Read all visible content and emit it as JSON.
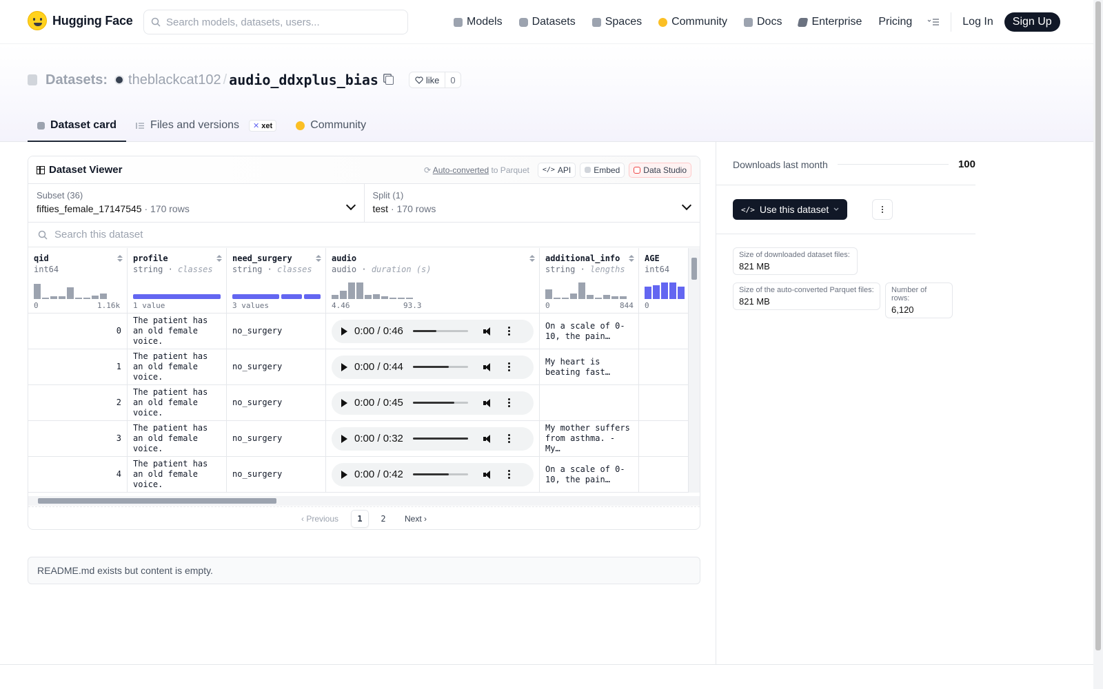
{
  "nav": {
    "brand": "Hugging Face",
    "search_placeholder": "Search models, datasets, users...",
    "links": [
      {
        "label": "Models",
        "icon": "cube-icon",
        "color": "#9ca3af"
      },
      {
        "label": "Datasets",
        "icon": "database-icon",
        "color": "#9ca3af"
      },
      {
        "label": "Spaces",
        "icon": "spaces-icon",
        "color": "#9ca3af"
      },
      {
        "label": "Community",
        "icon": "community-icon",
        "color": "#fbbf24"
      },
      {
        "label": "Docs",
        "icon": "book-icon",
        "color": "#9ca3af"
      },
      {
        "label": "Enterprise",
        "icon": "enterprise-icon",
        "color": "#6b7280"
      },
      {
        "label": "Pricing",
        "icon": "",
        "color": ""
      }
    ],
    "login": "Log In",
    "signup": "Sign Up"
  },
  "header": {
    "section": "Datasets:",
    "owner": "theblackcat102",
    "separator": "/",
    "repo": "audio_ddxplus_bias",
    "like_label": "like",
    "like_count": "0",
    "tabs": [
      {
        "label": "Dataset card",
        "icon": "cube-icon"
      },
      {
        "label": "Files and versions",
        "icon": "files-icon",
        "badge": "xet"
      },
      {
        "label": "Community",
        "icon": "community-icon"
      }
    ]
  },
  "viewer": {
    "title": "Dataset Viewer",
    "auto_link": "Auto-converted",
    "auto_rest": "to Parquet",
    "api": "API",
    "embed": "Embed",
    "studio": "Data Studio",
    "subset_label": "Subset (36)",
    "subset_value": "fifties_female_17147545",
    "subset_rows": "170 rows",
    "split_label": "Split (1)",
    "split_value": "test",
    "split_rows": "170 rows",
    "search_placeholder": "Search this dataset",
    "dot": "·",
    "columns": [
      {
        "name": "qid",
        "type": "int64",
        "sub": "",
        "min": "0",
        "max": "1.16k",
        "hist": [
          0.9,
          0,
          0.15,
          0.15,
          0.7,
          0,
          0,
          0.2,
          0.35
        ]
      },
      {
        "name": "profile",
        "type": "string",
        "sub": "classes",
        "min": "1 value",
        "max": "",
        "hist": []
      },
      {
        "name": "need_surgery",
        "type": "string",
        "sub": "classes",
        "min": "3 values",
        "max": "",
        "hist": []
      },
      {
        "name": "audio",
        "type": "audio",
        "sub": "duration (s)",
        "min": "4.46",
        "max": "93.3",
        "hist": [
          0.25,
          0.5,
          1.0,
          1.0,
          0.25,
          0.3,
          0.15,
          0,
          0.05,
          0.05
        ]
      },
      {
        "name": "additional_info",
        "type": "string",
        "sub": "lengths",
        "min": "0",
        "max": "844",
        "hist": [
          0.6,
          0.1,
          0,
          0.35,
          1.0,
          0.25,
          0.1,
          0.25,
          0.15,
          0.15
        ]
      },
      {
        "name": "AGE",
        "type": "int64",
        "sub": "",
        "min": "0",
        "max": "",
        "hist": [
          0.75,
          0.85,
          1.0,
          1.0,
          0.75
        ]
      }
    ],
    "rows": [
      {
        "qid": "0",
        "profile": "The patient has an old female voice.",
        "surgery": "no_surgery",
        "time": "0:00 / 0:46",
        "progress": 0.42,
        "info": "On a scale of 0-10, the pain…"
      },
      {
        "qid": "1",
        "profile": "The patient has an old female voice.",
        "surgery": "no_surgery",
        "time": "0:00 / 0:44",
        "progress": 0.65,
        "info": "My heart is beating fast…"
      },
      {
        "qid": "2",
        "profile": "The patient has an old female voice.",
        "surgery": "no_surgery",
        "time": "0:00 / 0:45",
        "progress": 0.75,
        "info": ""
      },
      {
        "qid": "3",
        "profile": "The patient has an old female voice.",
        "surgery": "no_surgery",
        "time": "0:00 / 0:32",
        "progress": 1.0,
        "info": "My mother suffers from asthma. - My…"
      },
      {
        "qid": "4",
        "profile": "The patient has an old female voice.",
        "surgery": "no_surgery",
        "time": "0:00 / 0:42",
        "progress": 0.65,
        "info": "On a scale of 0-10, the pain…"
      }
    ],
    "pager": {
      "prev": "Previous",
      "pages": [
        "1",
        "2"
      ],
      "next": "Next"
    }
  },
  "readme": "README.md exists but content is empty.",
  "sidebar": {
    "downloads_label": "Downloads last month",
    "downloads_value": "100",
    "use_label": "Use this dataset",
    "stats": [
      {
        "k": "Size of downloaded dataset files:",
        "v": "821 MB"
      },
      {
        "k": "Size of the auto-converted Parquet files:",
        "v": "821 MB"
      },
      {
        "k": "Number of rows:",
        "v": "6,120"
      }
    ]
  }
}
